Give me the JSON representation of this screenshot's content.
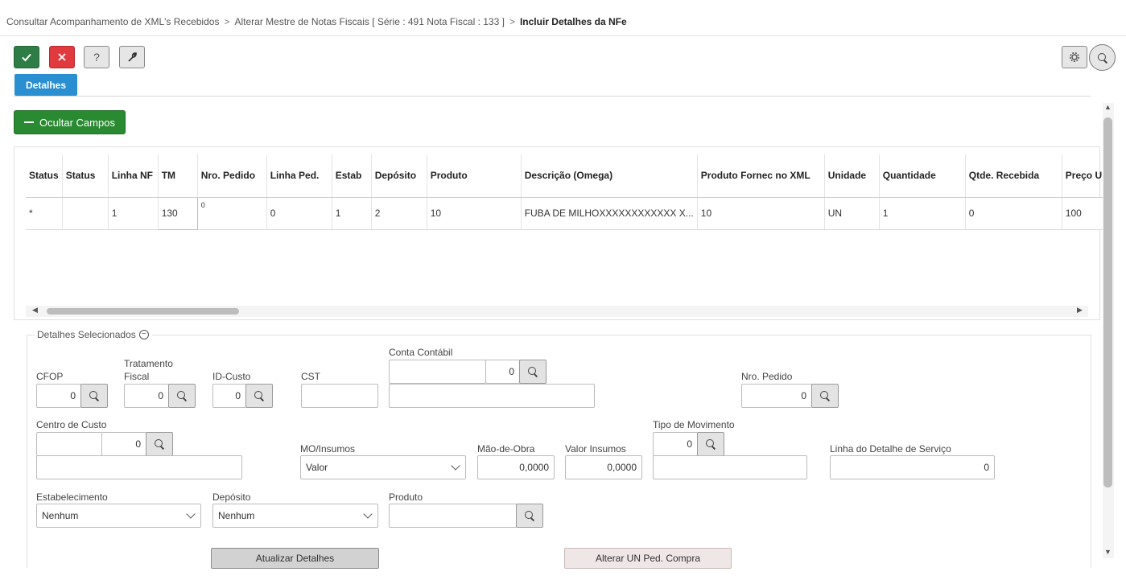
{
  "breadcrumb": {
    "items": [
      "Consultar Acompanhamento de XML's Recebidos",
      "Alterar Mestre de Notas Fiscais [ Série : 491 Nota Fiscal : 133 ]"
    ],
    "current": "Incluir Detalhes da NFe",
    "separator": ">"
  },
  "toolbar": {
    "ok_icon": "check-icon",
    "cancel_icon": "close-icon",
    "help_label": "?",
    "tool_icon": "wrench-icon",
    "gear_icon": "gear-icon",
    "search_icon": "search-icon"
  },
  "tabs": [
    {
      "label": "Detalhes",
      "active": true
    }
  ],
  "ocultar_button": {
    "label": "Ocultar Campos"
  },
  "grid": {
    "columns": [
      "Status",
      "Status",
      "Linha NF",
      "TM",
      "Nro. Pedido",
      "Linha Ped.",
      "Estab",
      "Depósito",
      "Produto",
      "Descrição (Omega)",
      "Produto Fornec no XML",
      "Unidade",
      "Quantidade",
      "Qtde. Recebida",
      "Preço Ur"
    ],
    "rows": [
      [
        "*",
        "",
        "1",
        "130",
        "0",
        "0",
        "1",
        "2",
        "10",
        "FUBA DE MILHOXXXXXXXXXXXX X...",
        "10",
        "UN",
        "1",
        "0",
        "100"
      ]
    ]
  },
  "details": {
    "legend": "Detalhes Selecionados",
    "cfop": {
      "label": "CFOP",
      "value": "0"
    },
    "tratamento_fiscal": {
      "label1": "Tratamento",
      "label2": "Fiscal",
      "value": "0"
    },
    "id_custo": {
      "label": "ID-Custo",
      "value": "0"
    },
    "cst": {
      "label": "CST",
      "value": ""
    },
    "conta_contabil": {
      "label": "Conta Contábil",
      "code": "",
      "value": "0",
      "description": ""
    },
    "nro_pedido": {
      "label": "Nro. Pedido",
      "value": "0"
    },
    "centro_custo": {
      "label": "Centro de Custo",
      "code": "",
      "value": "0",
      "description": ""
    },
    "mo_insumos": {
      "label": "MO/Insumos",
      "value": "Valor"
    },
    "mao_obra": {
      "label": "Mão-de-Obra",
      "value": "0,0000"
    },
    "valor_insumos": {
      "label": "Valor Insumos",
      "value": "0,0000"
    },
    "tipo_movimento": {
      "label": "Tipo de Movimento",
      "value": "0",
      "description": ""
    },
    "linha_detalhe_servico": {
      "label": "Linha do Detalhe de Serviço",
      "value": "0"
    },
    "estabelecimento": {
      "label": "Estabelecimento",
      "value": "Nenhum"
    },
    "deposito": {
      "label": "Depósito",
      "value": "Nenhum"
    },
    "produto": {
      "label": "Produto",
      "value": ""
    },
    "atualizar_label": "Atualizar Detalhes",
    "alterar_un_label": "Alterar UN Ped. Compra"
  },
  "scroll": {
    "left_arrow": "◀",
    "right_arrow": "▶",
    "up_arrow": "▲",
    "down_arrow": "▼"
  }
}
